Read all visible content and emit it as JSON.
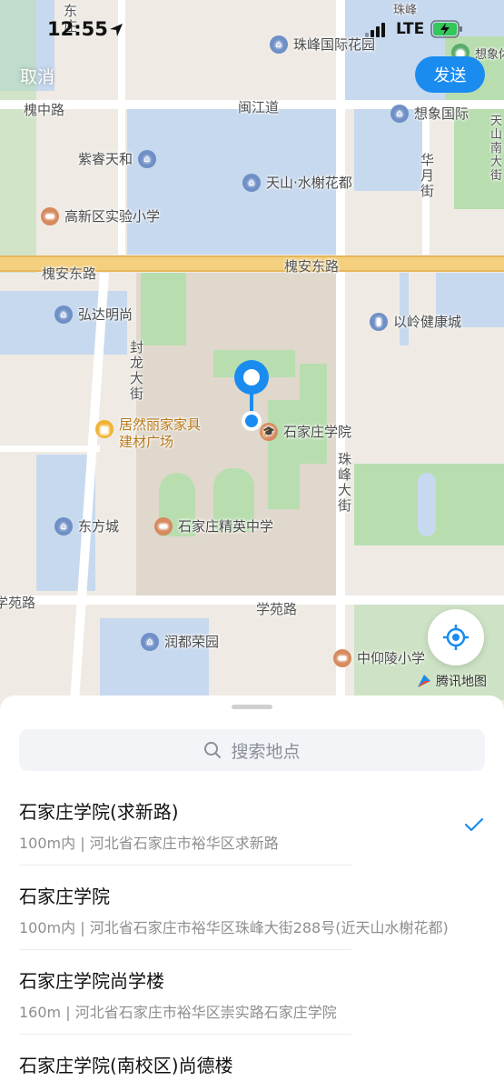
{
  "status_bar": {
    "time": "12:55",
    "network": "LTE"
  },
  "header": {
    "cancel_label": "取消",
    "send_label": "发送"
  },
  "map": {
    "roads": {
      "dongzhuang_1": "东",
      "dongzhuang_2": "庄",
      "zhufeng_top": "珠峰",
      "huaizhong": "槐中路",
      "minjiang": "闽江道",
      "huaian_east_1": "槐安东路",
      "huaian_east_2": "槐安东路",
      "fenglong": [
        "封",
        "龙",
        "大",
        "街"
      ],
      "zhufeng_street": [
        "珠",
        "峰",
        "大",
        "街"
      ],
      "huayue": [
        "华",
        "月",
        "街"
      ],
      "tianshan_south": [
        "天",
        "山",
        "南",
        "大",
        "街"
      ],
      "xueyuan_left": "学苑路",
      "xueyuan": "学苑路"
    },
    "pois": {
      "zhufeng_garden": "珠峰国际花园",
      "xiangxiang_sports": "想象体育",
      "xiangxiang_intl": "想象国际",
      "zirui": "紫睿天和",
      "tianshan_shuixie": "天山·水榭花都",
      "gaoxin_school": "高新区实验小学",
      "hongda": "弘达明尚",
      "yiling": "以岭健康城",
      "jurannijia_1": "居然丽家家具",
      "jurannijia_2": "建材广场",
      "sjz_university": "石家庄学院",
      "dongfang": "东方城",
      "sjz_jingying": "石家庄精英中学",
      "rundu": "润都荣园",
      "zhongyangling": "中仰陵小学"
    },
    "attribution": "腾讯地图"
  },
  "sheet": {
    "search_placeholder": "搜索地点",
    "results": [
      {
        "title": "石家庄学院(求新路)",
        "subtitle": "100m内 | 河北省石家庄市裕华区求新路",
        "selected": true
      },
      {
        "title": "石家庄学院",
        "subtitle": "100m内 | 河北省石家庄市裕华区珠峰大街288号(近天山水榭花都)",
        "selected": false
      },
      {
        "title": "石家庄学院尚学楼",
        "subtitle": "160m | 河北省石家庄市裕华区崇实路石家庄学院",
        "selected": false
      },
      {
        "title": "石家庄学院(南校区)尚德楼",
        "subtitle": "",
        "selected": false
      }
    ]
  },
  "colors": {
    "accent": "#1a8cf0",
    "pin": "#1a8cf0",
    "major_road": "#f3cf7e",
    "water": "#c7d9ee",
    "green": "#b8deb0"
  },
  "icons": [
    "location-arrow-icon",
    "signal-icon",
    "battery-charging-icon",
    "search-icon",
    "checkmark-icon",
    "locate-me-icon",
    "map-pin-icon",
    "tencent-map-logo"
  ]
}
